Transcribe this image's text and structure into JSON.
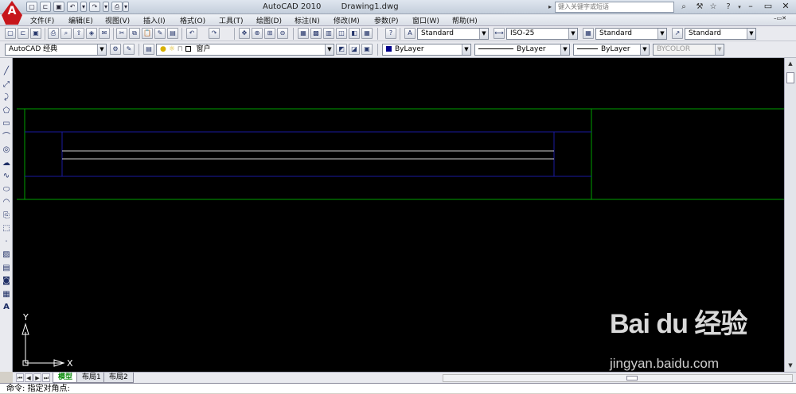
{
  "title": {
    "app": "AutoCAD 2010",
    "document": "Drawing1.dwg",
    "logo_letter": "A",
    "search_placeholder": "键入关键字或短语"
  },
  "menu": [
    "文件(F)",
    "编辑(E)",
    "视图(V)",
    "插入(I)",
    "格式(O)",
    "工具(T)",
    "绘图(D)",
    "标注(N)",
    "修改(M)",
    "参数(P)",
    "窗口(W)",
    "帮助(H)"
  ],
  "toolbar1": {
    "text_style": "Standard",
    "dim_style": "ISO-25",
    "table_style": "Standard",
    "mleader_style": "Standard"
  },
  "toolbar2": {
    "workspace": "AutoCAD 经典",
    "layer": "窗户",
    "color": "ByLayer",
    "linetype": "ByLayer",
    "lineweight": "ByLayer",
    "plotstyle": "BYCOLOR"
  },
  "ucs": {
    "x_label": "X",
    "y_label": "Y"
  },
  "tabs": [
    "模型",
    "布局1",
    "布局2"
  ],
  "command_line": "命令: 指定对角点:",
  "watermark": {
    "logo": "Bai du 经验",
    "sub": "jingyan.baidu.com"
  },
  "colors": {
    "canvas": "#000000",
    "green_lines": "#00a000",
    "blue_lines": "#1a1aa0",
    "white_lines": "#d0d0d0",
    "active_tab": "#0a8a0a"
  },
  "icons": {
    "quick_access": [
      "new-icon",
      "open-icon",
      "save-icon",
      "undo-icon",
      "redo-icon",
      "plot-icon"
    ],
    "left_toolbar": [
      "line-icon",
      "construction-line-icon",
      "polyline-icon",
      "polygon-icon",
      "rectangle-icon",
      "arc-icon",
      "circle-icon",
      "revision-cloud-icon",
      "spline-icon",
      "ellipse-icon",
      "ellipse-arc-icon",
      "insert-block-icon",
      "make-block-icon",
      "point-icon",
      "hatch-icon",
      "gradient-icon",
      "region-icon",
      "table-icon",
      "mtext-icon"
    ]
  }
}
